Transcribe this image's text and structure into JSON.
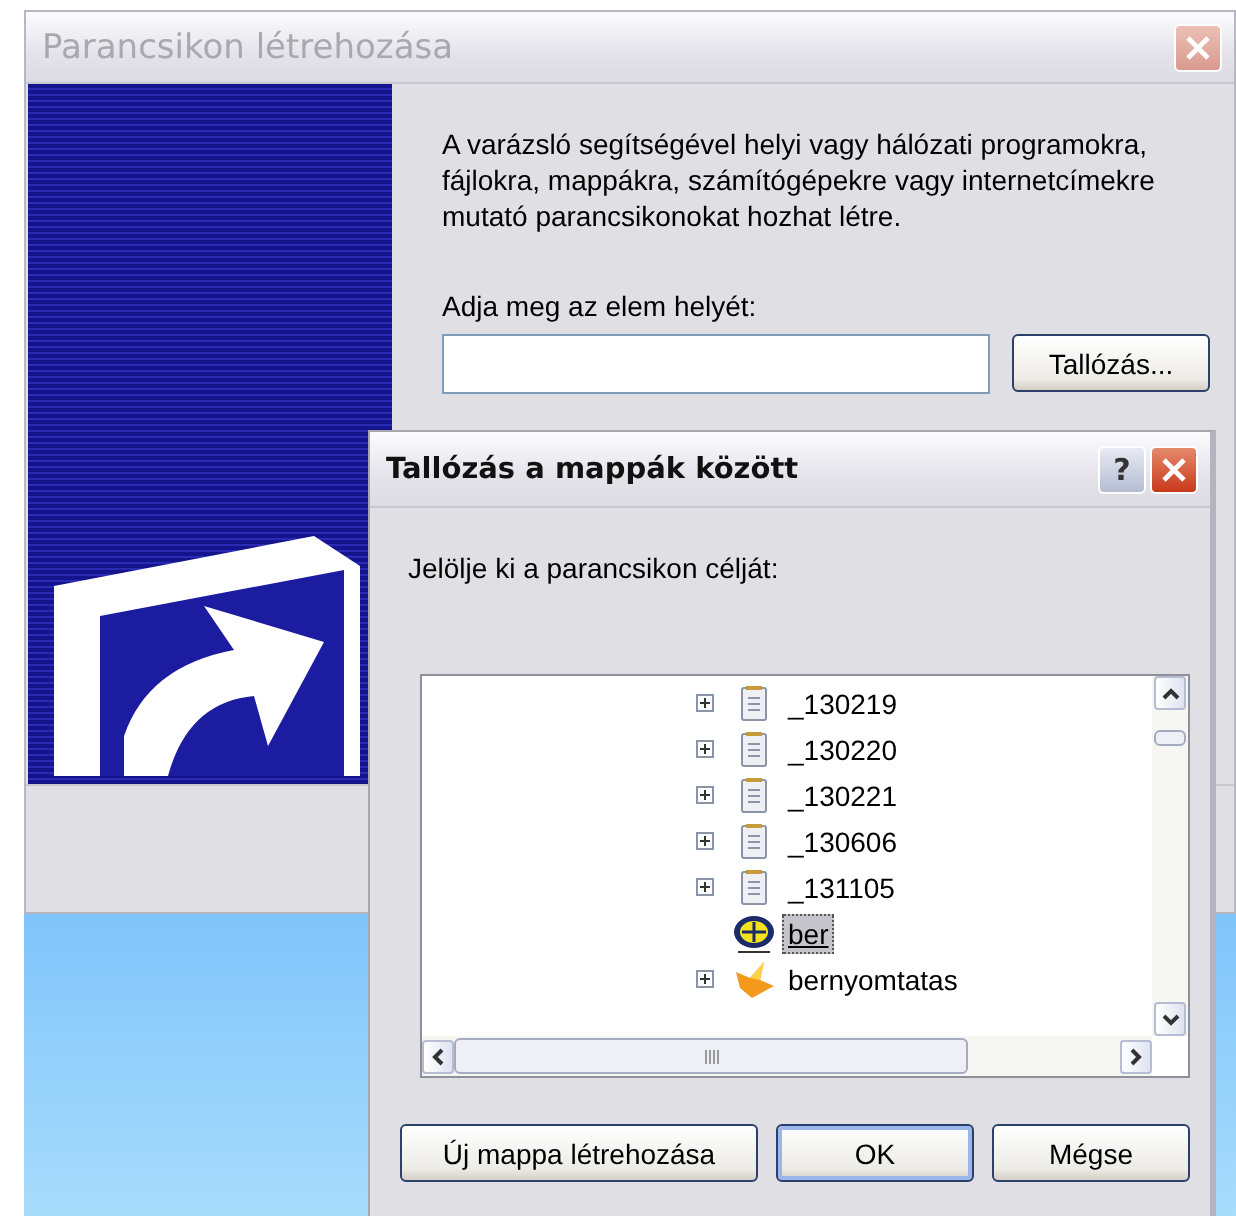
{
  "wizard": {
    "title": "Parancsikon létrehozása",
    "active": false,
    "description": "A varázsló segítségével helyi vagy hálózati programokra, fájlokra, mappákra, számítógépekre vagy internetcímekre mutató parancsikonokat hozhat létre.",
    "location_label": "Adja meg az elem helyét:",
    "browse_button": "Tallózás..."
  },
  "browse_dialog": {
    "title": "Tallózás a mappák között",
    "active": true,
    "help_button": "?",
    "prompt": "Jelölje ki a parancsikon célját:",
    "tree": [
      {
        "label": "_130219",
        "kind": "notepad",
        "expandable": true,
        "selected": false,
        "hovered": false
      },
      {
        "label": "_130220",
        "kind": "notepad",
        "expandable": true,
        "selected": false,
        "hovered": false
      },
      {
        "label": "_130221",
        "kind": "notepad",
        "expandable": true,
        "selected": false,
        "hovered": false
      },
      {
        "label": "_130606",
        "kind": "notepad",
        "expandable": true,
        "selected": false,
        "hovered": false
      },
      {
        "label": "_131105",
        "kind": "notepad",
        "expandable": true,
        "selected": false,
        "hovered": false
      },
      {
        "label": "ber",
        "kind": "badge",
        "expandable": false,
        "selected": true,
        "hovered": true
      },
      {
        "label": "bernyomtatas",
        "kind": "fox",
        "expandable": true,
        "selected": false,
        "hovered": false
      }
    ],
    "buttons": [
      {
        "label": "Új mappa létrehozása",
        "default": false
      },
      {
        "label": "OK",
        "default": true
      },
      {
        "label": "Mégse",
        "default": false
      }
    ]
  }
}
